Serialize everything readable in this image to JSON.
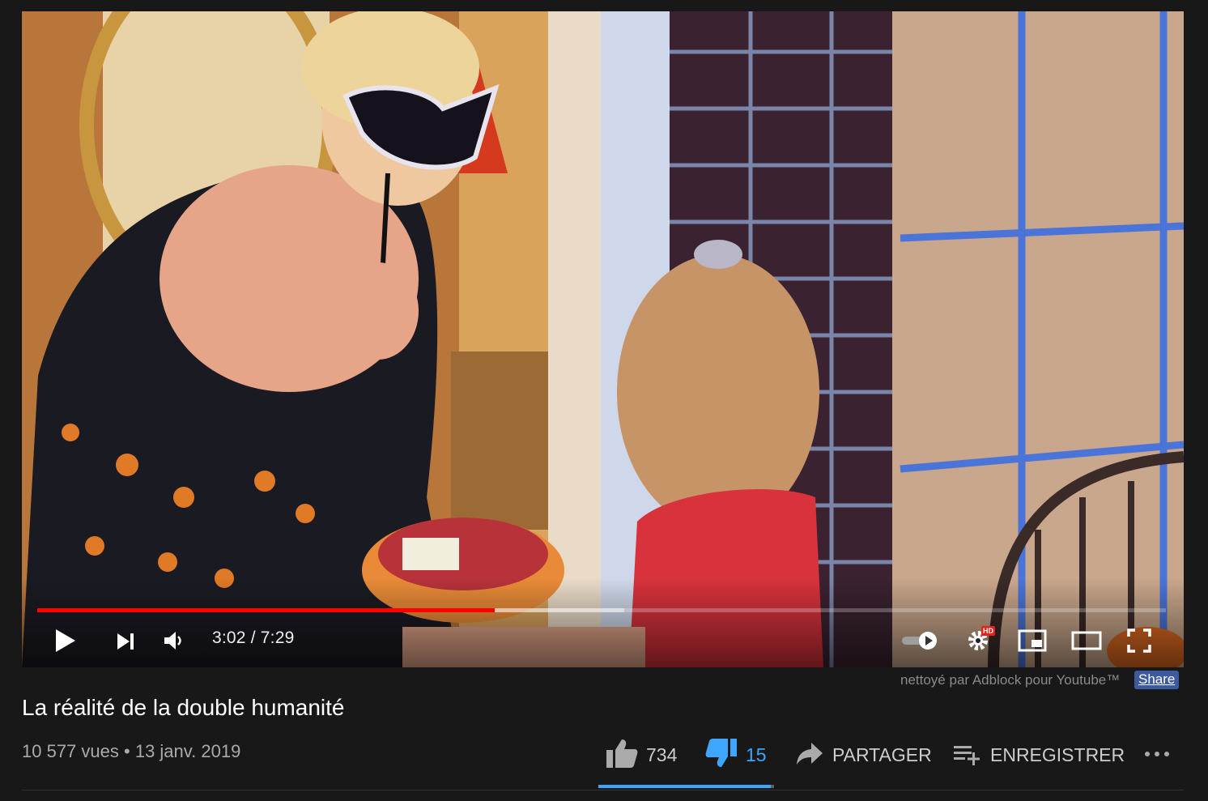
{
  "player": {
    "current_time": "3:02",
    "duration": "7:29",
    "time_display": "3:02 / 7:29",
    "played_fraction": 0.405,
    "buffered_fraction": 0.52,
    "hd_badge": "HD",
    "colors": {
      "played": "#ff0000",
      "hd": "#e62117"
    }
  },
  "adblock": {
    "text": "nettoyé par Adblock pour Youtube™",
    "share_label": "Share"
  },
  "video": {
    "title": "La réalité de la double humanité",
    "views": "10 577 vues",
    "separator": "•",
    "date": "13 janv. 2019",
    "meta_line": "10 577 vues • 13 janv. 2019"
  },
  "actions": {
    "likes": "734",
    "dislikes": "15",
    "share_label": "PARTAGER",
    "save_label": "ENREGISTRER",
    "like_fraction": 0.98,
    "accent": "#3ea6ff"
  },
  "icons": [
    "play-icon",
    "next-icon",
    "volume-icon",
    "autoplay-toggle-icon",
    "settings-icon",
    "miniplayer-icon",
    "theater-icon",
    "fullscreen-icon",
    "thumbs-up-icon",
    "thumbs-down-icon",
    "share-arrow-icon",
    "playlist-add-icon",
    "more-icon"
  ]
}
